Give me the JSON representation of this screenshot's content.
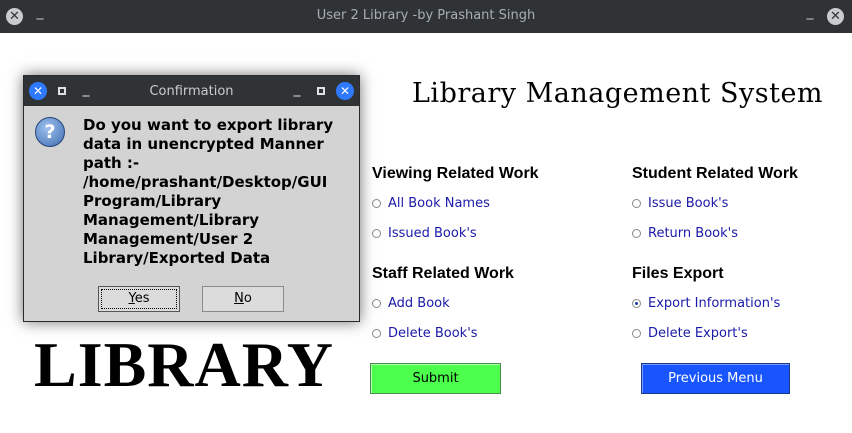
{
  "window": {
    "title": "User 2 Library -by Prashant Singh"
  },
  "app": {
    "heading": "Library Management System",
    "logo_text": "LIBRARY"
  },
  "sections": {
    "viewing": {
      "title": "Viewing Related Work",
      "options": [
        "All Book Names",
        "Issued Book's"
      ]
    },
    "student": {
      "title": "Student Related Work",
      "options": [
        "Issue Book's",
        "Return Book's"
      ]
    },
    "staff": {
      "title": "Staff Related Work",
      "options": [
        "Add Book",
        "Delete Book's"
      ]
    },
    "files": {
      "title": "Files Export",
      "options": [
        "Export Information's",
        "Delete Export's"
      ],
      "selected": "Export Information's"
    }
  },
  "buttons": {
    "submit": "Submit",
    "previous": "Previous Menu"
  },
  "dialog": {
    "title": "Confirmation",
    "message": "Do you want to export library\ndata in unencrypted Manner\npath :-\n/home/prashant/Desktop/GUI\nProgram/Library\nManagement/Library\nManagement/User 2\nLibrary/Exported Data",
    "yes_mnemonic": "Y",
    "yes_rest": "es",
    "no_mnemonic": "N",
    "no_rest": "o"
  },
  "colors": {
    "submit_bg": "#4cff4c",
    "previous_bg": "#1955ff",
    "option_text": "#1a1aa8",
    "titlebar_bg": "#2f3336"
  },
  "icons": [
    "close-icon",
    "minimize-icon",
    "maximize-icon",
    "question-icon"
  ]
}
